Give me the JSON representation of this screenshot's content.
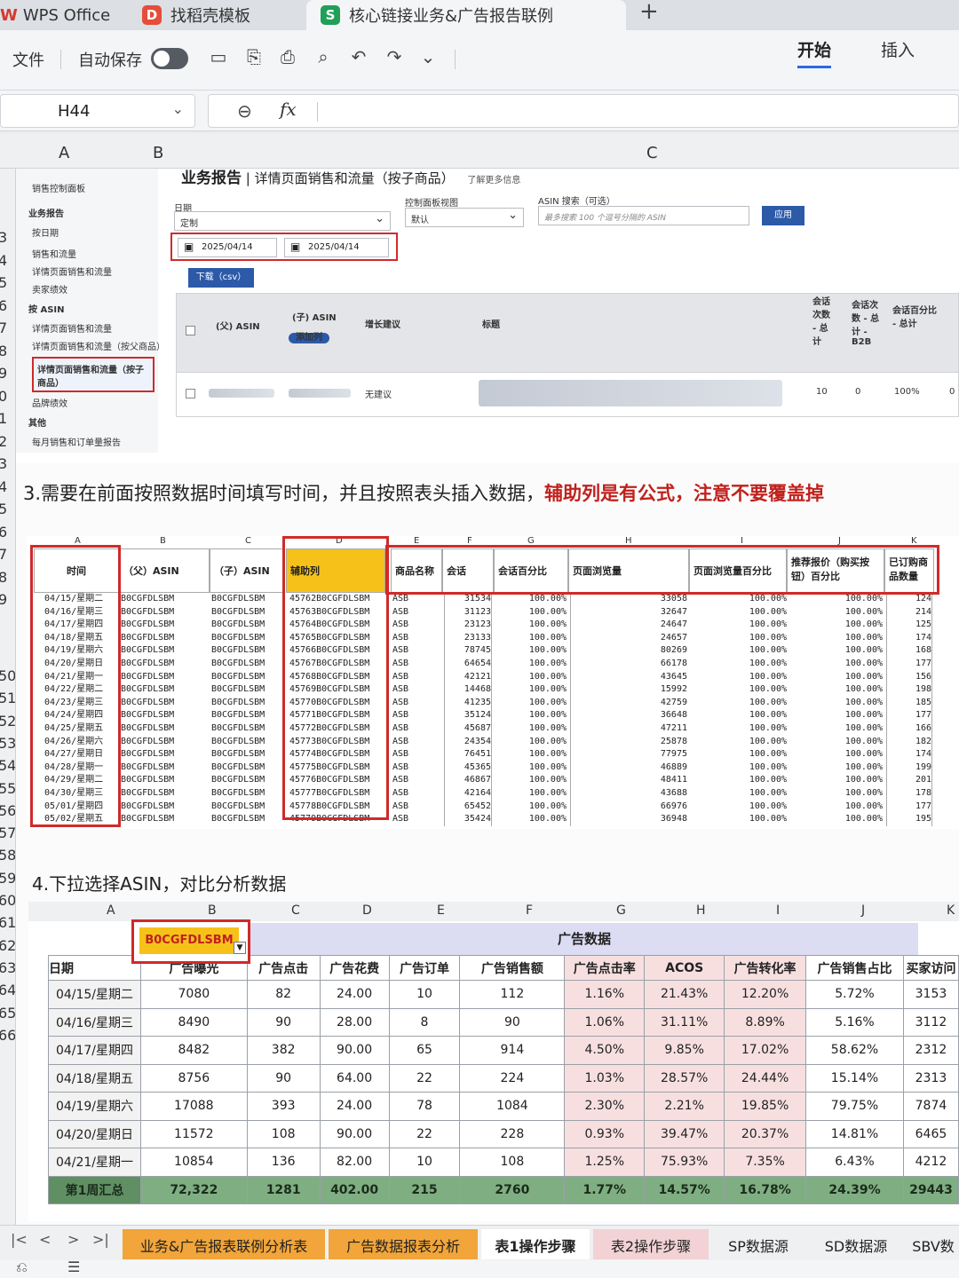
{
  "titlebar": {
    "wps_label": "WPS Office",
    "template_tab": "找稻壳模板",
    "doc_tab": "核心链接业务&广告报告联例"
  },
  "toolbar": {
    "file": "文件",
    "autosave": "自动保存",
    "menu_start": "开始",
    "menu_insert": "插入"
  },
  "formula_bar": {
    "cell_ref": "H44",
    "fx": "fx"
  },
  "columns": {
    "a": "A",
    "b": "B",
    "c": "C"
  },
  "row_numbers": [
    "3",
    "4",
    "5",
    "6",
    "7",
    "8",
    "9",
    "0",
    "1",
    "2",
    "3",
    "4",
    "5",
    "6",
    "7",
    "8",
    "9",
    "50",
    "51",
    "52",
    "53",
    "54",
    "55",
    "56",
    "57",
    "58",
    "59",
    "60",
    "61",
    "62",
    "63",
    "64",
    "65",
    "66"
  ],
  "shot1": {
    "nav": [
      "销售控制面板",
      "业务报告",
      "按日期",
      "销售和流量",
      "详情页面销售和流量",
      "卖家绩效",
      "按 ASIN",
      "详情页面销售和流量",
      "详情页面销售和流量（按父商品）",
      "详情页面销售和流量（按子商品）",
      "品牌绩效",
      "其他",
      "每月销售和订单量报告"
    ],
    "title_bold": "业务报告",
    "title_rest": "| 详情页面销售和流量（按子商品）",
    "learn_more": "了解更多信息",
    "date_label": "日期",
    "date_value": "定制",
    "view_label": "控制面板视图",
    "view_value": "默认",
    "asin_label": "ASIN 搜索（可选）",
    "asin_placeholder": "最多搜索 100 个逗号分隔的 ASIN",
    "apply": "应用",
    "date_from": "2025/04/14",
    "date_to": "2025/04/14",
    "download": "下载（csv）",
    "headers": [
      "(父) ASIN",
      "(子) ASIN",
      "增长建议",
      "标题",
      "会话次数 - 总计",
      "会话次数 - 总计 - B2B",
      "会话百分比 - 总计"
    ],
    "add_pill": "添加列",
    "row": {
      "suggestion": "无建议",
      "v1": "10",
      "v2": "0",
      "v3": "100%",
      "v4": "0"
    }
  },
  "step3": {
    "plain": "3.需要在前面按照数据时间填写时间，并且按照表头插入数据，",
    "em": "辅助列是有公式，注意不要覆盖掉"
  },
  "table1": {
    "colletters": [
      "A",
      "B",
      "C",
      "D",
      "E",
      "F",
      "G",
      "H",
      "I",
      "J",
      "K"
    ],
    "headers": [
      "时间",
      "（父）ASIN",
      "（子）ASIN",
      "辅助列",
      "商品名称",
      "会话",
      "会话百分比",
      "页面浏览量",
      "页面浏览量百分比",
      "推荐报价（购买按钮）百分比",
      "已订购商品数量"
    ],
    "dates": "04/15/星期二\n04/16/星期三\n04/17/星期四\n04/18/星期五\n04/19/星期六\n04/20/星期日\n04/21/星期一\n04/22/星期二\n04/23/星期三\n04/24/星期四\n04/25/星期五\n04/26/星期六\n04/27/星期日\n04/28/星期一\n04/29/星期二\n04/30/星期三\n05/01/星期四\n05/02/星期五",
    "parent": "B0CGFDLSBM\nB0CGFDLSBM\nB0CGFDLSBM\nB0CGFDLSBM\nB0CGFDLSBM\nB0CGFDLSBM\nB0CGFDLSBM\nB0CGFDLSBM\nB0CGFDLSBM\nB0CGFDLSBM\nB0CGFDLSBM\nB0CGFDLSBM\nB0CGFDLSBM\nB0CGFDLSBM\nB0CGFDLSBM\nB0CGFDLSBM\nB0CGFDLSBM\nB0CGFDLSBM",
    "child": "B0CGFDLSBM\nB0CGFDLSBM\nB0CGFDLSBM\nB0CGFDLSBM\nB0CGFDLSBM\nB0CGFDLSBM\nB0CGFDLSBM\nB0CGFDLSBM\nB0CGFDLSBM\nB0CGFDLSBM\nB0CGFDLSBM\nB0CGFDLSBM\nB0CGFDLSBM\nB0CGFDLSBM\nB0CGFDLSBM\nB0CGFDLSBM\nB0CGFDLSBM\nB0CGFDLSBM",
    "helper": "45762B0CGFDLSBM\n45763B0CGFDLSBM\n45764B0CGFDLSBM\n45765B0CGFDLSBM\n45766B0CGFDLSBM\n45767B0CGFDLSBM\n45768B0CGFDLSBM\n45769B0CGFDLSBM\n45770B0CGFDLSBM\n45771B0CGFDLSBM\n45772B0CGFDLSBM\n45773B0CGFDLSBM\n45774B0CGFDLSBM\n45775B0CGFDLSBM\n45776B0CGFDLSBM\n45777B0CGFDLSBM\n45778B0CGFDLSBM\n45779B0CGFDLSBM",
    "name": "ASB\nASB\nASB\nASB\nASB\nASB\nASB\nASB\nASB\nASB\nASB\nASB\nASB\nASB\nASB\nASB\nASB\nASB",
    "sessions": "31534\n31123\n23123\n23133\n78745\n64654\n42121\n14468\n41235\n35124\n45687\n24354\n76451\n45365\n46867\n42164\n65452\n35424",
    "session_pct": "100.00%\n100.00%\n100.00%\n100.00%\n100.00%\n100.00%\n100.00%\n100.00%\n100.00%\n100.00%\n100.00%\n100.00%\n100.00%\n100.00%\n100.00%\n100.00%\n100.00%\n100.00%",
    "pageviews": "33058\n32647\n24647\n24657\n80269\n66178\n43645\n15992\n42759\n36648\n47211\n25878\n77975\n46889\n48411\n43688\n66976\n36948",
    "pv_pct": "100.00%\n100.00%\n100.00%\n100.00%\n100.00%\n100.00%\n100.00%\n100.00%\n100.00%\n100.00%\n100.00%\n100.00%\n100.00%\n100.00%\n100.00%\n100.00%\n100.00%\n100.00%",
    "bb_pct": "100.00%\n100.00%\n100.00%\n100.00%\n100.00%\n100.00%\n100.00%\n100.00%\n100.00%\n100.00%\n100.00%\n100.00%\n100.00%\n100.00%\n100.00%\n100.00%\n100.00%\n100.00%",
    "units": "124\n214\n125\n174\n168\n177\n156\n198\n185\n177\n166\n182\n174\n199\n201\n178\n177\n195"
  },
  "step4": "4.下拉选择ASIN，对比分析数据",
  "table2": {
    "colletters": [
      "A",
      "B",
      "C",
      "D",
      "E",
      "F",
      "G",
      "H",
      "I",
      "J",
      "K"
    ],
    "asin": "B0CGFDLSBM",
    "banner": "广告数据",
    "headers": [
      "日期",
      "广告曝光",
      "广告点击",
      "广告花费",
      "广告订单",
      "广告销售额",
      "广告点击率",
      "ACOS",
      "广告转化率",
      "广告销售占比",
      "买家访问"
    ],
    "rows": [
      [
        "04/15/星期二",
        "7080",
        "82",
        "24.00",
        "10",
        "112",
        "1.16%",
        "21.43%",
        "12.20%",
        "5.72%",
        "3153"
      ],
      [
        "04/16/星期三",
        "8490",
        "90",
        "28.00",
        "8",
        "90",
        "1.06%",
        "31.11%",
        "8.89%",
        "5.16%",
        "3112"
      ],
      [
        "04/17/星期四",
        "8482",
        "382",
        "90.00",
        "65",
        "914",
        "4.50%",
        "9.85%",
        "17.02%",
        "58.62%",
        "2312"
      ],
      [
        "04/18/星期五",
        "8756",
        "90",
        "64.00",
        "22",
        "224",
        "1.03%",
        "28.57%",
        "24.44%",
        "15.14%",
        "2313"
      ],
      [
        "04/19/星期六",
        "17088",
        "393",
        "24.00",
        "78",
        "1084",
        "2.30%",
        "2.21%",
        "19.85%",
        "79.75%",
        "7874"
      ],
      [
        "04/20/星期日",
        "11572",
        "108",
        "90.00",
        "22",
        "228",
        "0.93%",
        "39.47%",
        "20.37%",
        "14.81%",
        "6465"
      ],
      [
        "04/21/星期一",
        "10854",
        "136",
        "82.00",
        "10",
        "108",
        "1.25%",
        "75.93%",
        "7.35%",
        "6.43%",
        "4212"
      ]
    ],
    "summary": [
      "第1周汇总",
      "72,322",
      "1281",
      "402.00",
      "215",
      "2760",
      "1.77%",
      "14.57%",
      "16.78%",
      "24.39%",
      "29443"
    ]
  },
  "sheet_tabs": [
    "业务&广告报表联例分析表",
    "广告数据报表分析",
    "表1操作步骤",
    "表2操作步骤",
    "SP数据源",
    "SD数据源",
    "SBV数"
  ],
  "colors": {
    "accent": "#2b6be4",
    "red": "#d02a2a",
    "orange_tab": "#f1a53a",
    "pink_tab": "#f2d2d4",
    "summary_green": "#7fae82"
  }
}
